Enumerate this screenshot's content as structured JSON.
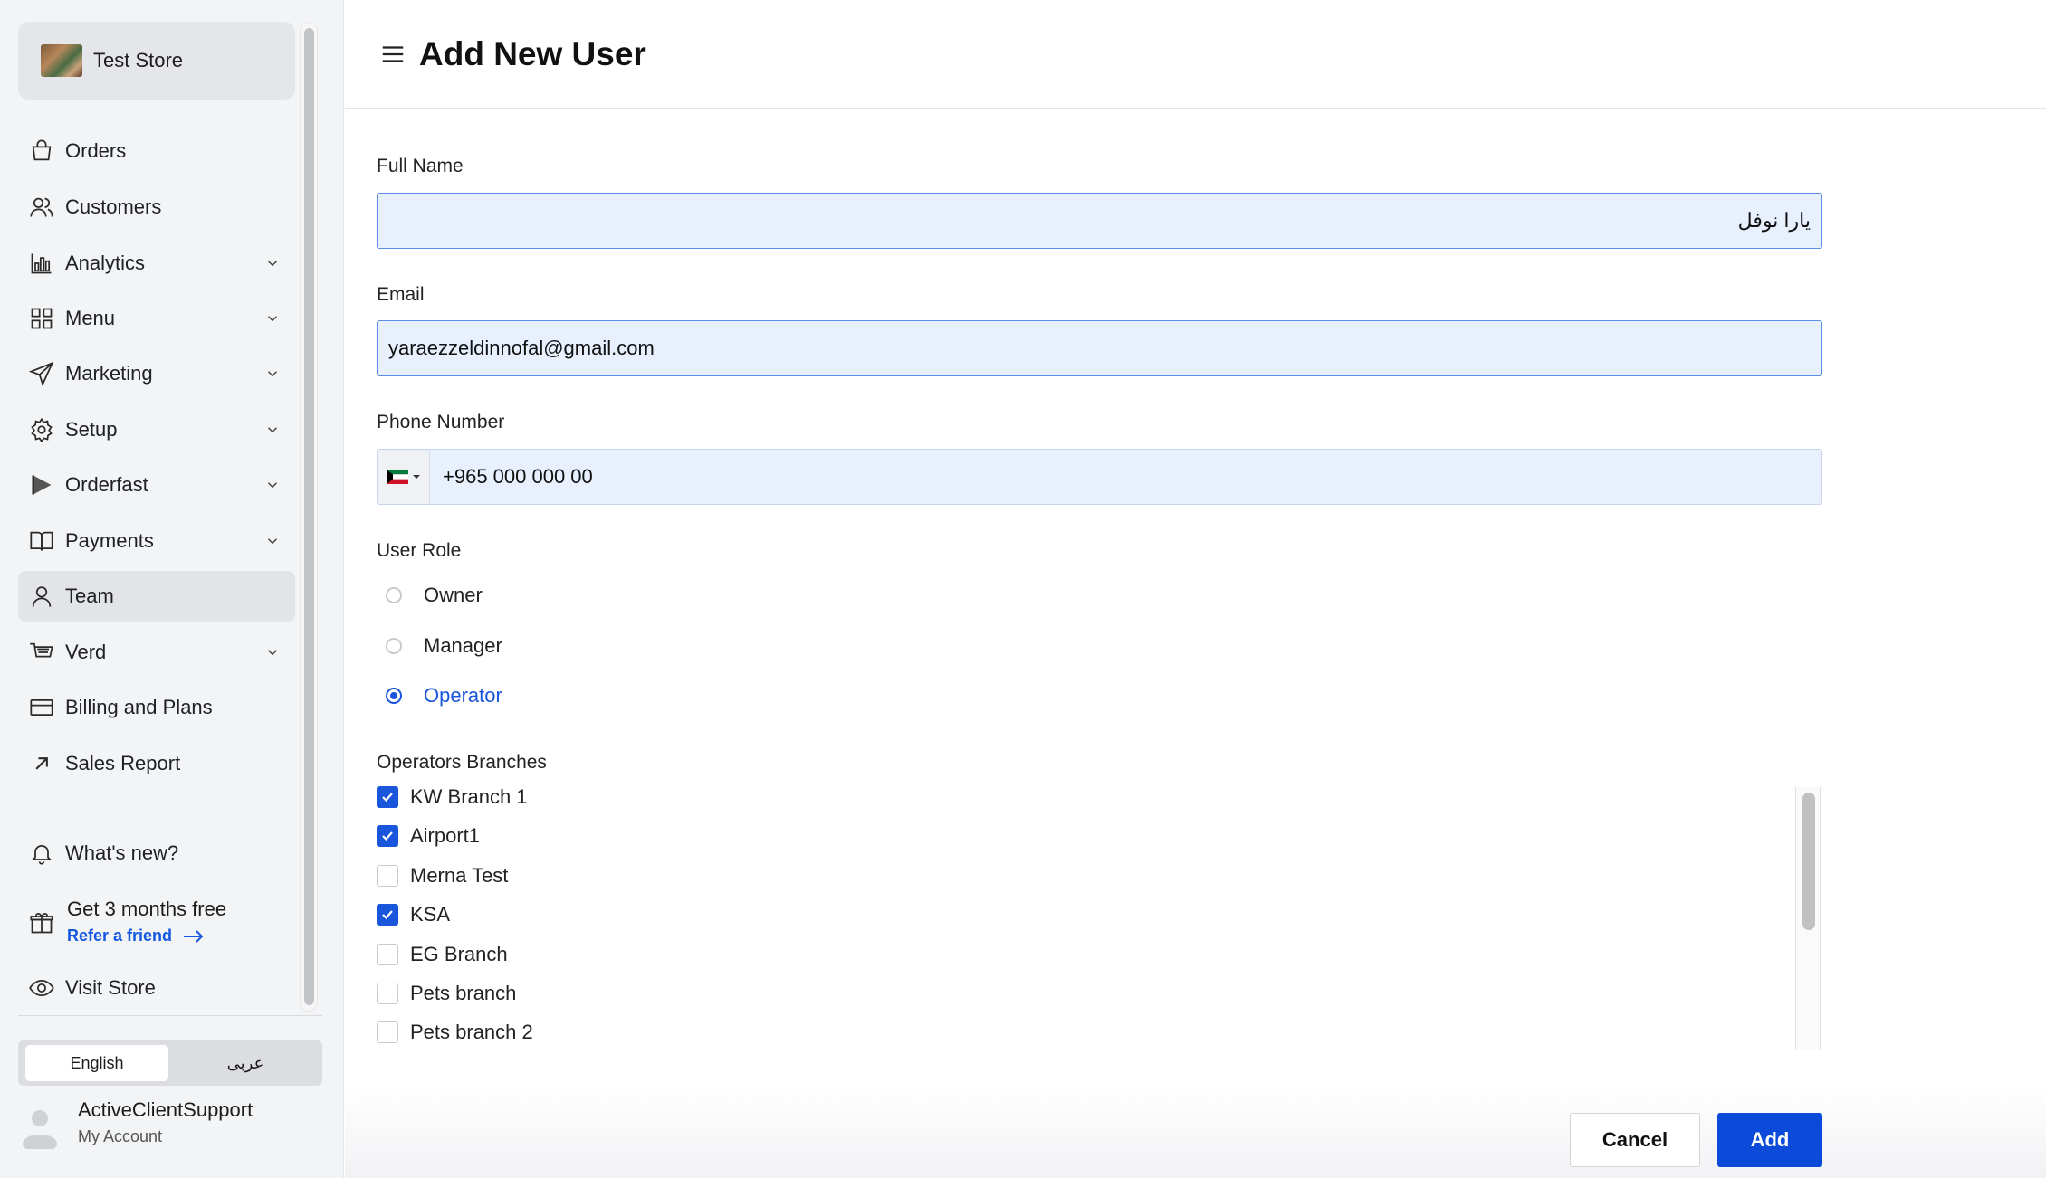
{
  "store": {
    "name": "Test Store"
  },
  "sidebar": {
    "items": [
      {
        "label": "Orders",
        "icon": "shopping-bag-icon",
        "expandable": false
      },
      {
        "label": "Customers",
        "icon": "users-icon",
        "expandable": false
      },
      {
        "label": "Analytics",
        "icon": "bar-chart-icon",
        "expandable": true
      },
      {
        "label": "Menu",
        "icon": "grid-icon",
        "expandable": true
      },
      {
        "label": "Marketing",
        "icon": "send-icon",
        "expandable": true
      },
      {
        "label": "Setup",
        "icon": "gear-icon",
        "expandable": true
      },
      {
        "label": "Orderfast",
        "icon": "play-icon",
        "expandable": true
      },
      {
        "label": "Payments",
        "icon": "book-icon",
        "expandable": true
      },
      {
        "label": "Team",
        "icon": "user-icon",
        "expandable": false,
        "active": true
      },
      {
        "label": "Verd",
        "icon": "cart-icon",
        "expandable": true
      },
      {
        "label": "Billing and Plans",
        "icon": "credit-card-icon",
        "expandable": false
      },
      {
        "label": "Sales Report",
        "icon": "arrow-up-right-icon",
        "expandable": false
      }
    ],
    "whats_new": "What's new?",
    "refer": {
      "title": "Get 3 months free",
      "link": "Refer a friend"
    },
    "visit_store": "Visit Store",
    "language": {
      "english": "English",
      "arabic": "عربى",
      "selected": "English"
    },
    "account": {
      "name": "ActiveClientSupport",
      "sub": "My Account"
    }
  },
  "header": {
    "title": "Add New User"
  },
  "form": {
    "full_name": {
      "label": "Full Name",
      "value": "يارا نوفل"
    },
    "email": {
      "label": "Email",
      "value": "yaraezzeldinnofal@gmail.com"
    },
    "phone": {
      "label": "Phone Number",
      "value": "+965 000 000 00",
      "country": "Kuwait"
    },
    "role": {
      "label": "User Role",
      "options": [
        "Owner",
        "Manager",
        "Operator"
      ],
      "selected": "Operator"
    },
    "branches": {
      "label": "Operators Branches",
      "items": [
        {
          "name": "KW Branch 1",
          "checked": true
        },
        {
          "name": "Airport1",
          "checked": true
        },
        {
          "name": "Merna Test",
          "checked": false
        },
        {
          "name": "KSA",
          "checked": true
        },
        {
          "name": "EG Branch",
          "checked": false
        },
        {
          "name": "Pets branch",
          "checked": false
        },
        {
          "name": "Pets branch 2",
          "checked": false
        }
      ]
    }
  },
  "actions": {
    "cancel": "Cancel",
    "add": "Add"
  },
  "colors": {
    "accent": "#1a56db",
    "add_button": "#0c4bd9",
    "input_fill": "#e8f0fe"
  }
}
